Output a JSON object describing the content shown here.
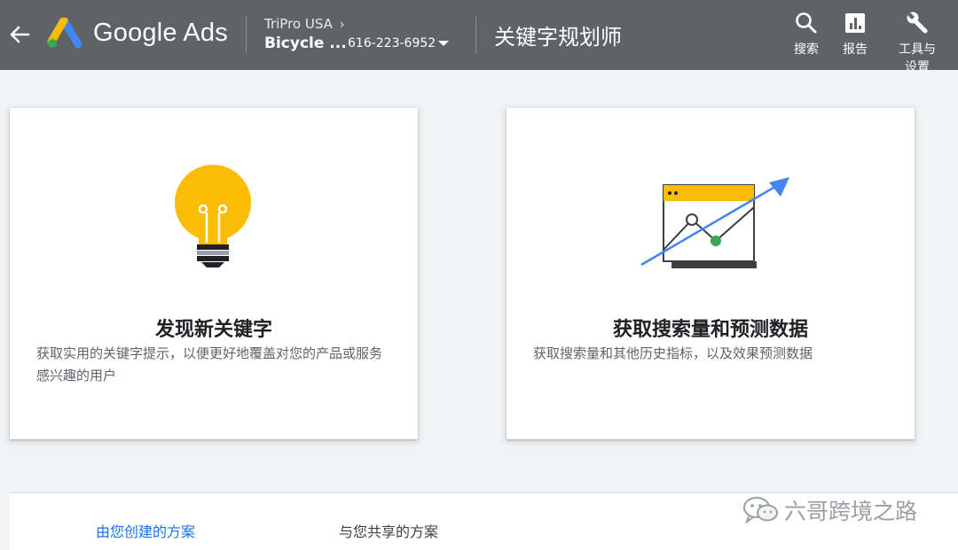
{
  "header": {
    "brand": "Google Ads",
    "account_parent": "TriPro USA",
    "account_name": "Bicycle ...",
    "account_id": "616-223-6952",
    "page_title": "关键字规划师",
    "tools": [
      {
        "label": "搜索",
        "icon": "search-icon"
      },
      {
        "label": "报告",
        "icon": "bar-chart-icon"
      },
      {
        "label": "工具与设置",
        "icon": "wrench-icon"
      }
    ]
  },
  "cards": [
    {
      "title": "发现新关键字",
      "description": "获取实用的关键字提示，以便更好地覆盖对您的产品或服务感兴趣的用户",
      "icon": "lightbulb-icon"
    },
    {
      "title": "获取搜索量和预测数据",
      "description": "获取搜索量和其他历史指标，以及效果预测数据",
      "icon": "forecast-chart-icon"
    }
  ],
  "tabs": [
    {
      "label": "由您创建的方案",
      "active": true
    },
    {
      "label": "与您共享的方案",
      "active": false
    }
  ],
  "watermark": "六哥跨境之路",
  "colors": {
    "header_bg": "#5f6368",
    "page_bg": "#f1f3f4",
    "accent_blue": "#1a73e8",
    "bulb_yellow": "#fbbc04",
    "point_green": "#34a853",
    "arrow_blue": "#4285f4"
  }
}
